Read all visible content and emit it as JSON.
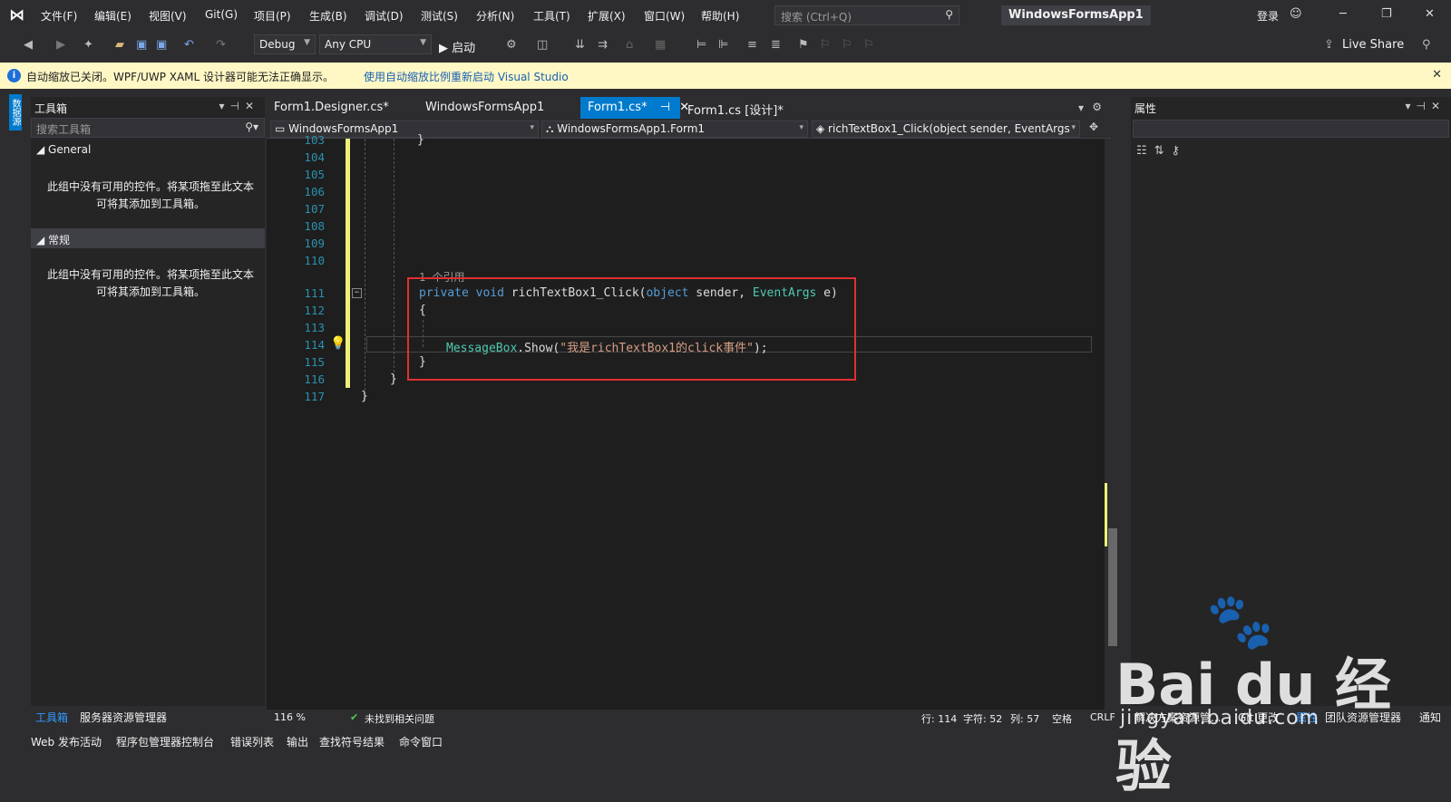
{
  "menu": {
    "items": [
      "文件(F)",
      "编辑(E)",
      "视图(V)",
      "Git(G)",
      "项目(P)",
      "生成(B)",
      "调试(D)",
      "测试(S)",
      "分析(N)",
      "工具(T)",
      "扩展(X)",
      "窗口(W)",
      "帮助(H)"
    ],
    "search_placeholder": "搜索 (Ctrl+Q)",
    "app_title": "WindowsFormsApp1",
    "login": "登录"
  },
  "toolbar": {
    "config": "Debug",
    "platform": "Any CPU",
    "start": "▶ 启动",
    "live_share": "Live Share"
  },
  "infobar": {
    "message": "自动缩放已关闭。WPF/UWP XAML 设计器可能无法正确显示。",
    "link": "使用自动缩放比例重新启动 Visual Studio"
  },
  "left_strip": {
    "tab": "数据源"
  },
  "toolbox": {
    "title": "工具箱",
    "search_placeholder": "搜索工具箱",
    "groups": [
      {
        "name": "General",
        "empty": "此组中没有可用的控件。将某项拖至此文本可将其添加到工具箱。"
      },
      {
        "name": "常规",
        "empty": "此组中没有可用的控件。将某项拖至此文本可将其添加到工具箱。"
      }
    ],
    "tab_toolbox": "工具箱",
    "tab_server": "服务器资源管理器"
  },
  "editor": {
    "tabs": [
      "Form1.Designer.cs*",
      "WindowsFormsApp1",
      "Form1.cs*",
      "Form1.cs [设计]*"
    ],
    "nav_project": "WindowsFormsApp1",
    "nav_class": "WindowsFormsApp1.Form1",
    "nav_member": "richTextBox1_Click(object sender, EventArgs",
    "line_numbers": [
      "103",
      "104",
      "105",
      "106",
      "107",
      "108",
      "109",
      "110",
      "111",
      "112",
      "113",
      "114",
      "115",
      "116",
      "117"
    ],
    "code_lens": "1 个引用",
    "kw_private": "private",
    "kw_void": "void",
    "method": "richTextBox1_Click(",
    "kw_object": "object",
    "sender": " sender, ",
    "type_eventargs": "EventArgs",
    "param_e": " e)",
    "brace_open": "{",
    "brace_close": "}",
    "msgbox_type": "MessageBox",
    "show_call": ".Show(",
    "string_literal": "\"我是richTextBox1的click事件\"",
    "end_call": ");",
    "closing_103": "}",
    "closing_116": "}",
    "closing_117": "}"
  },
  "editor_status": {
    "zoom": "116 %",
    "issues": "未找到相关问题",
    "line": "行: 114",
    "char": "字符: 52",
    "col": "列: 57",
    "space": "空格",
    "crlf": "CRLF"
  },
  "properties": {
    "title": "属性",
    "tabs": [
      "解决方案资源管...",
      "Git 更改",
      "属性",
      "团队资源管理器",
      "通知"
    ]
  },
  "bottom": {
    "items": [
      "Web 发布活动",
      "程序包管理器控制台",
      "错误列表",
      "输出",
      "查找符号结果",
      "命令窗口"
    ]
  },
  "watermark": {
    "brand": "Bai du 经验",
    "url": "jingyan.baidu.com"
  },
  "colors": {
    "accent": "#007acc",
    "info_bg": "#fff8c5",
    "highlight_box": "#e03030",
    "keyword": "#569cd6",
    "type": "#4ec9b0",
    "string": "#d69d85"
  }
}
